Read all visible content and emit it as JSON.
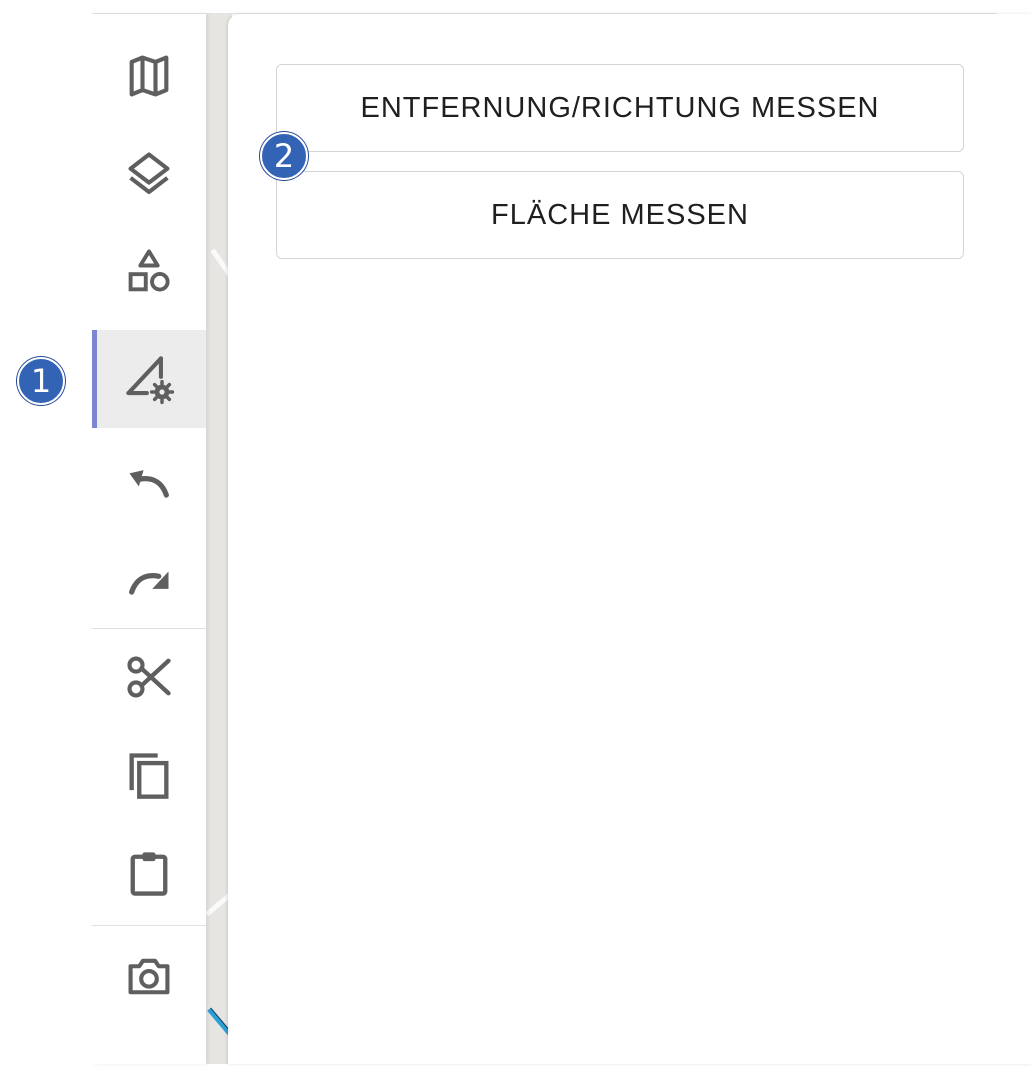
{
  "colors": {
    "accent": "#7b86cf",
    "icon": "#5f5f5f",
    "badge": "#3363b5"
  },
  "toolbar": {
    "items": [
      {
        "name": "map",
        "icon": "map-icon",
        "active": false
      },
      {
        "name": "layers",
        "icon": "layers-icon",
        "active": false
      },
      {
        "name": "shapes",
        "icon": "shapes-icon",
        "active": false
      },
      {
        "name": "measure",
        "icon": "measure-settings-icon",
        "active": true
      },
      {
        "name": "undo",
        "icon": "undo-icon",
        "active": false
      },
      {
        "name": "redo",
        "icon": "redo-icon",
        "active": false
      },
      {
        "name": "cut",
        "icon": "scissors-icon",
        "active": false
      },
      {
        "name": "copy",
        "icon": "copy-icon",
        "active": false
      },
      {
        "name": "paste",
        "icon": "clipboard-icon",
        "active": false
      },
      {
        "name": "screenshot",
        "icon": "camera-icon",
        "active": false
      }
    ]
  },
  "panel": {
    "distance_button_label": "ENTFERNUNG/RICHTUNG MESSEN",
    "area_button_label": "FLÄCHE MESSEN"
  },
  "annotations": {
    "badge1": "1",
    "badge2": "2"
  }
}
